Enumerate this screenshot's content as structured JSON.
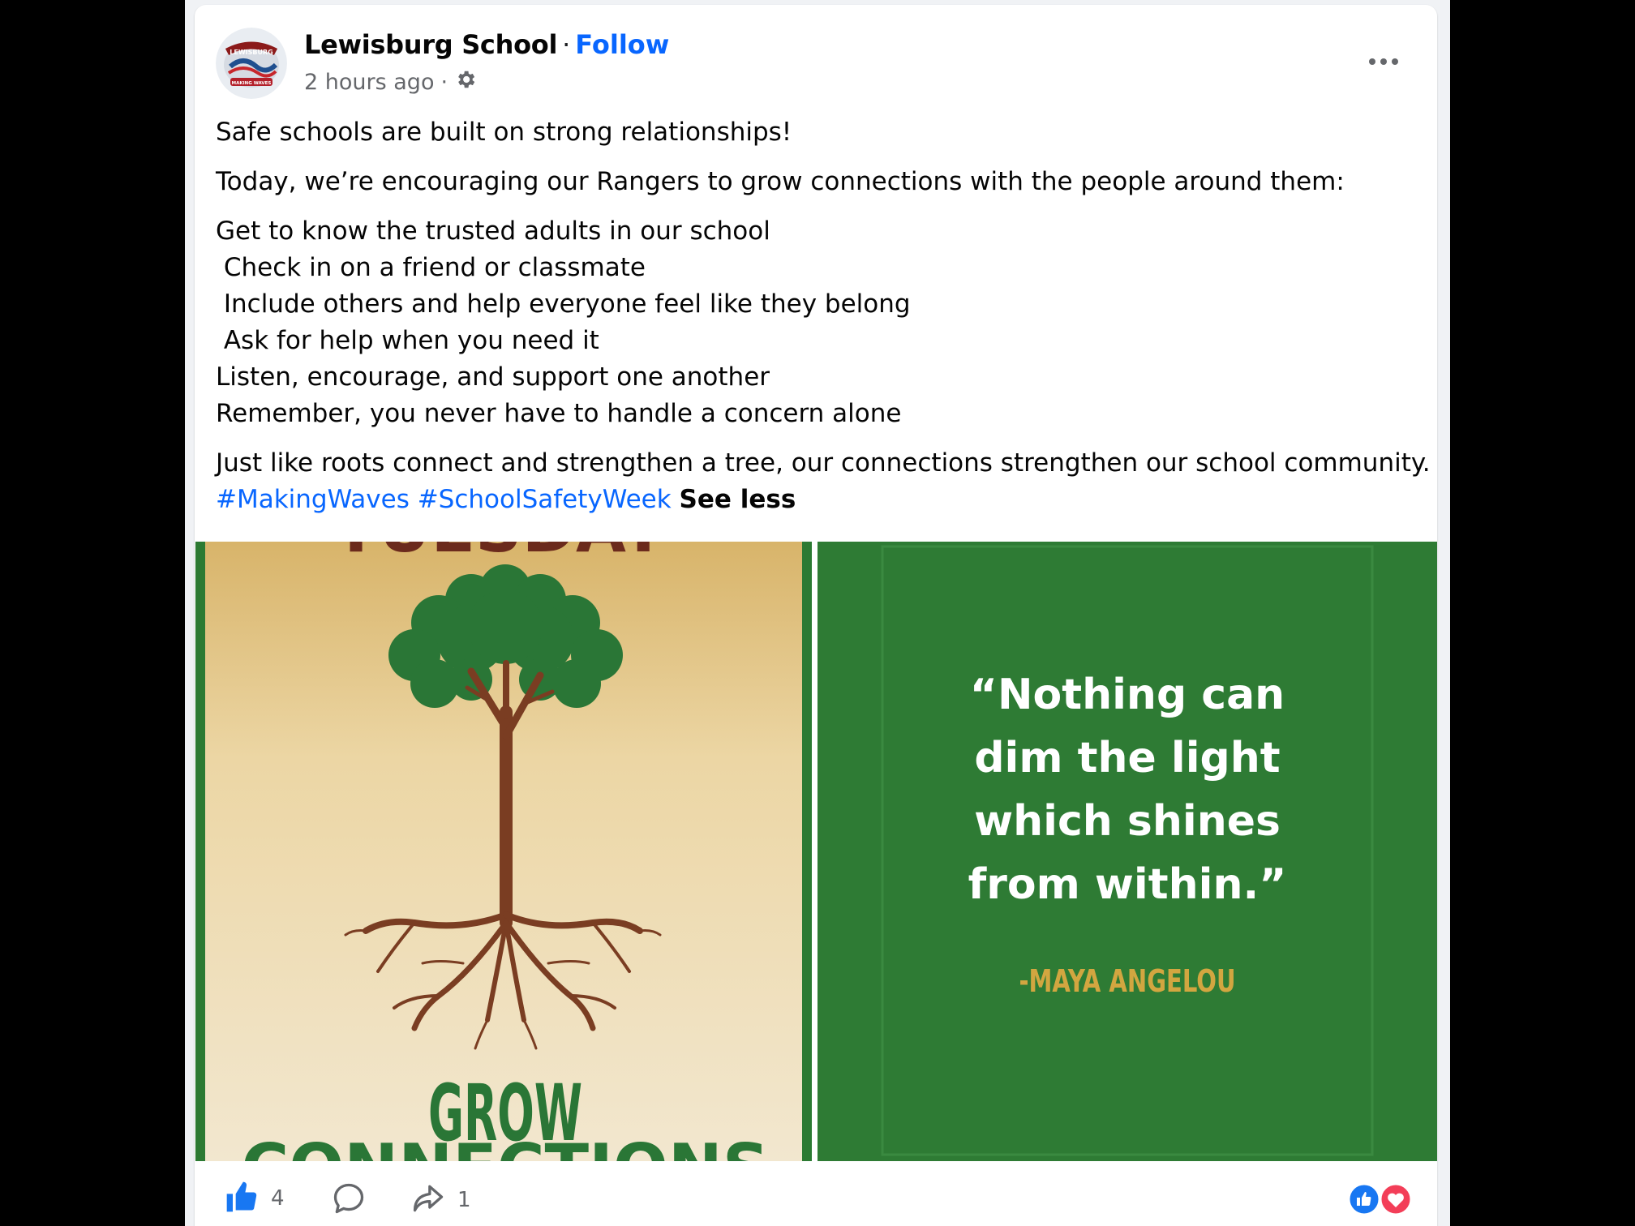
{
  "post": {
    "author": "Lewisburg School",
    "separator": "·",
    "follow_label": "Follow",
    "time": "2 hours ago",
    "meta_separator": "·",
    "avatar_text_top": "LEWISBURG",
    "avatar_text_bottom": "MAKING WAVES",
    "paragraph1": "Safe schools are built on strong relationships!",
    "paragraph2": "Today, we’re encouraging our Rangers to grow connections with the people around them:",
    "list": [
      "Get to know the trusted adults in our school",
      " Check in on a friend or classmate",
      " Include others and help everyone feel like they belong",
      " Ask for help when you need it",
      "Listen, encourage, and support one another",
      "Remember, you never have to handle a concern alone"
    ],
    "paragraph3": "Just like roots connect and strengthen a tree, our connections strengthen our school community.",
    "hashtag1": "#MakingWaves",
    "hashtag2": "#SchoolSafetyWeek",
    "see_less": "See less"
  },
  "images": {
    "left": {
      "top_text": "TUESDAY",
      "grow": "GROW",
      "bottom_text": "CONNECTIONS",
      "bg_top": "#d8b46a",
      "bg_bottom": "#f2e7cf"
    },
    "right": {
      "quote_lines": [
        "“Nothing can",
        "dim the light",
        "which shines",
        "from within.”"
      ],
      "attribution": "-MAYA ANGELOU",
      "bg": "#2e7b34"
    }
  },
  "footer": {
    "like_count": "4",
    "share_count": "1"
  },
  "icons": {
    "settings": "gear-icon",
    "more": "more-options-icon",
    "like": "thumbs-up-icon",
    "comment": "comment-icon",
    "share": "share-icon",
    "reactions": "reaction-icons"
  },
  "colors": {
    "link": "#0866ff",
    "text": "#050505",
    "secondary": "#65676b",
    "green": "#2e7b34",
    "like_blue": "#1877f2",
    "love_red": "#f33e58"
  }
}
